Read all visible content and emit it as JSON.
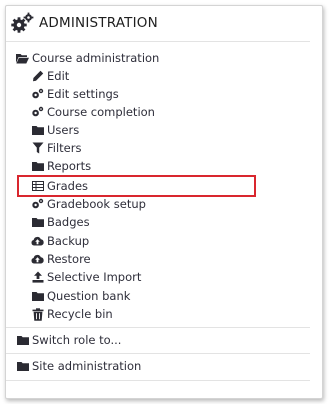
{
  "block": {
    "title": "ADMINISTRATION",
    "title_icon": "cogs-icon"
  },
  "course_admin": {
    "label": "Course administration",
    "icon": "folder-open-icon",
    "items": [
      {
        "label": "Edit",
        "icon": "pencil-icon"
      },
      {
        "label": "Edit settings",
        "icon": "cogs-icon"
      },
      {
        "label": "Course completion",
        "icon": "cogs-icon"
      },
      {
        "label": "Users",
        "icon": "folder-icon"
      },
      {
        "label": "Filters",
        "icon": "filter-icon"
      },
      {
        "label": "Reports",
        "icon": "folder-icon"
      },
      {
        "label": "Grades",
        "icon": "table-icon"
      },
      {
        "label": "Gradebook setup",
        "icon": "cogs-icon"
      },
      {
        "label": "Badges",
        "icon": "folder-icon"
      },
      {
        "label": "Backup",
        "icon": "cloud-upload-icon"
      },
      {
        "label": "Restore",
        "icon": "cloud-upload-icon"
      },
      {
        "label": "Selective Import",
        "icon": "upload-icon"
      },
      {
        "label": "Question bank",
        "icon": "folder-icon"
      },
      {
        "label": "Recycle bin",
        "icon": "trash-icon"
      }
    ]
  },
  "switch_role": {
    "label": "Switch role to...",
    "icon": "folder-icon"
  },
  "site_admin": {
    "label": "Site administration",
    "icon": "folder-icon"
  },
  "colors": {
    "highlight_border": "#d9262e",
    "text": "#2e2e3a",
    "icon": "#2b2b33"
  }
}
